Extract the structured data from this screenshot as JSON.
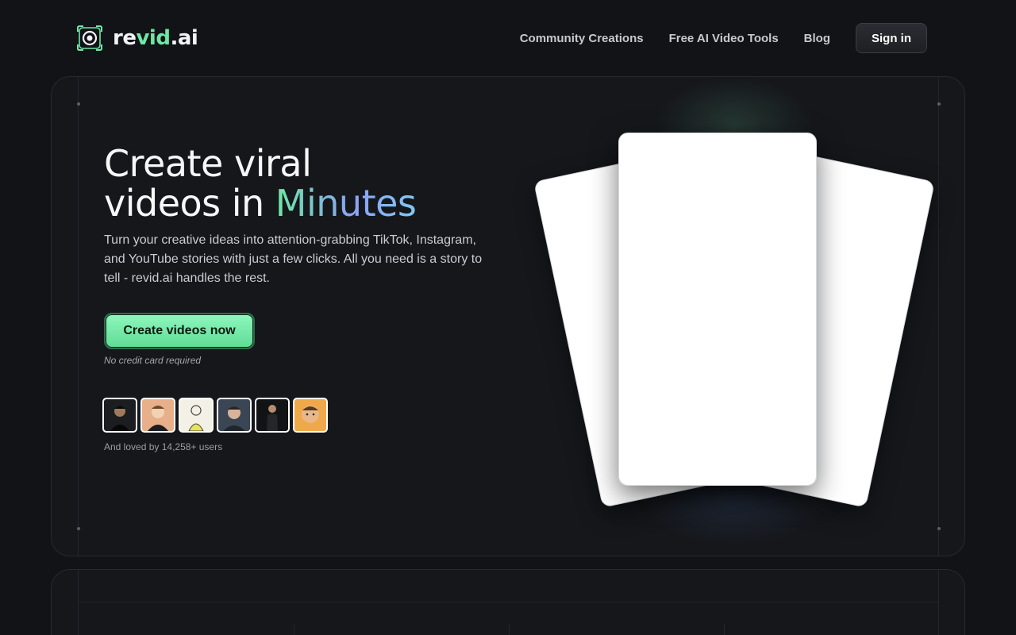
{
  "brand": {
    "name_part1": "re",
    "name_accent": "vid",
    "name_part2": ".ai",
    "logo_icon": "camera-eye-icon",
    "accent_color": "#6ee7a4"
  },
  "nav": {
    "links": [
      {
        "label": "Community Creations"
      },
      {
        "label": "Free AI Video Tools"
      },
      {
        "label": "Blog"
      }
    ],
    "sign_in_label": "Sign in"
  },
  "hero": {
    "headline_line1": "Create viral",
    "headline_line2_prefix": "videos in ",
    "headline_highlight": "Minutes",
    "subtitle": "Turn your creative ideas into attention-grabbing TikTok, Instagram, and YouTube stories with just a few clicks. All you need is a story to tell - revid.ai handles the rest.",
    "cta_label": "Create videos now",
    "cta_color": "#6ee7a4",
    "no_credit_card": "No credit card required",
    "loved_by": "And loved by 14,258+ users"
  },
  "avatars": [
    {
      "name": "user-avatar-1",
      "bg": "#1b1d20"
    },
    {
      "name": "user-avatar-2",
      "bg": "#e8b08a"
    },
    {
      "name": "user-avatar-3",
      "bg": "#f3f1e6"
    },
    {
      "name": "user-avatar-4",
      "bg": "#3a4654"
    },
    {
      "name": "user-avatar-5",
      "bg": "#121314"
    },
    {
      "name": "user-avatar-6",
      "bg": "#f0a94a"
    }
  ]
}
